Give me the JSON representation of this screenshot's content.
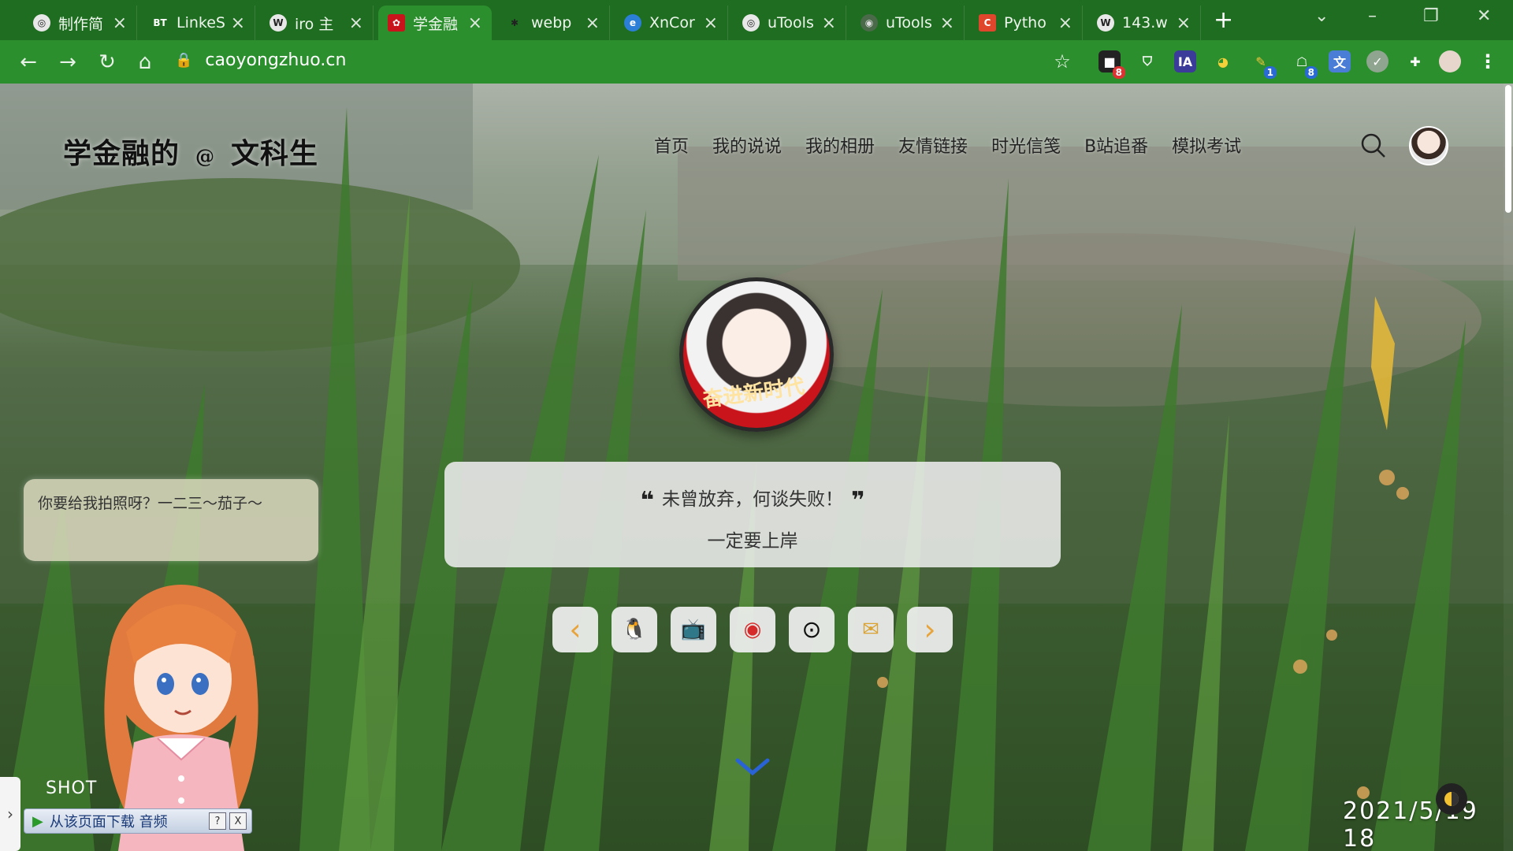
{
  "browser": {
    "tabs": [
      {
        "title": "制作简",
        "favicon": "globe-icon",
        "active": false
      },
      {
        "title": "LinkeS",
        "favicon": "BT",
        "active": false
      },
      {
        "title": "iro 主",
        "favicon": "wordpress-icon",
        "active": false
      },
      {
        "title": "学金融",
        "favicon": "avatar-icon",
        "active": true
      },
      {
        "title": "webp",
        "favicon": "puzzle-icon",
        "active": false
      },
      {
        "title": "XnCor",
        "favicon": "edge-icon",
        "active": false
      },
      {
        "title": "uTools",
        "favicon": "globe-icon",
        "active": false
      },
      {
        "title": "uTools",
        "favicon": "github-icon",
        "active": false
      },
      {
        "title": "Pytho",
        "favicon": "C",
        "active": false
      },
      {
        "title": "143.w",
        "favicon": "wordpress-icon",
        "active": false
      }
    ],
    "url": "caoyongzhuo.cn",
    "extension_badges": {
      "first": "8",
      "sixth": "1",
      "seventh": "8"
    },
    "extension_ia_label": "IA",
    "theme_color": "#2c8f2e"
  },
  "site": {
    "logo_main": "学金融的",
    "logo_at": "@",
    "logo_sub": "文科生",
    "nav": [
      {
        "label": "首页"
      },
      {
        "label": "我的说说"
      },
      {
        "label": "我的相册"
      },
      {
        "label": "友情链接"
      },
      {
        "label": "时光信笺"
      },
      {
        "label": "B站追番"
      },
      {
        "label": "模拟考试"
      }
    ],
    "profile_banner": "奋进新时代",
    "quote_open": "❝",
    "quote_text": "未曾放弃，何谈失败！",
    "quote_close": "❞",
    "quote_sub": "一定要上岸",
    "social_buttons": [
      {
        "icon": "prev-arrow-icon",
        "glyph": "‹"
      },
      {
        "icon": "qq-icon",
        "glyph": "🐧"
      },
      {
        "icon": "bilibili-icon",
        "glyph": "📺"
      },
      {
        "icon": "weibo-icon",
        "glyph": "◉"
      },
      {
        "icon": "github-icon",
        "glyph": "⊙"
      },
      {
        "icon": "email-icon",
        "glyph": "✉"
      },
      {
        "icon": "next-arrow-icon",
        "glyph": "›"
      }
    ],
    "mascot_bubble": "你要给我拍照呀？一二三～茄子～",
    "shot_label": "SHOT",
    "download_bar_text": "从该页面下载 音频",
    "download_bar_help": "?",
    "download_bar_close": "X",
    "clock": "2021/5/19 18",
    "left_toggle": "›"
  }
}
